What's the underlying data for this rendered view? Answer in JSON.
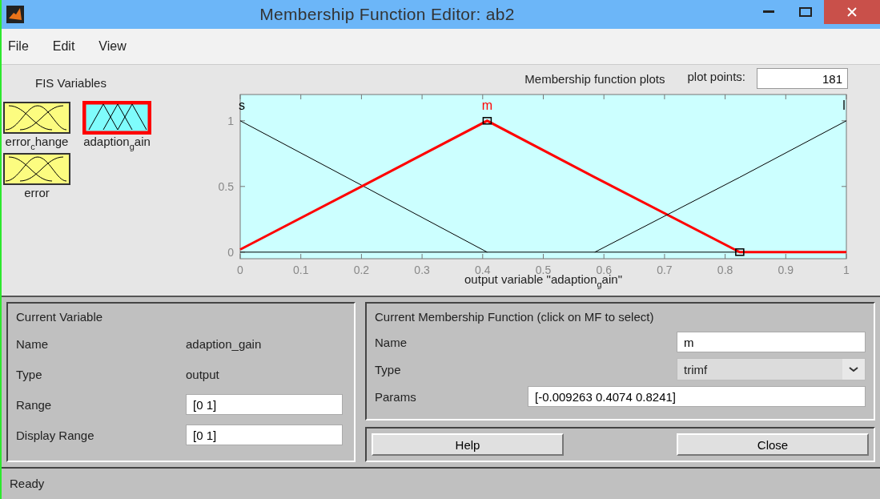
{
  "window": {
    "title": "Membership Function Editor: ab2"
  },
  "menu": [
    "File",
    "Edit",
    "View"
  ],
  "fis_variables": {
    "title": "FIS Variables",
    "items": [
      {
        "label": "error$_{c}$hange",
        "kind": "input",
        "selected": false
      },
      {
        "label": "adaption$_{g}$ain",
        "kind": "output",
        "selected": true
      },
      {
        "label": "error",
        "kind": "input",
        "selected": false
      }
    ]
  },
  "plot": {
    "title": "Membership function plots",
    "plot_points_label": "plot points:",
    "plot_points": "181",
    "chart_data": {
      "type": "line",
      "xlabel": "output variable \"adaption$_{g}$ain\"",
      "x": [
        0,
        0.2,
        0.4074,
        0.585,
        0.8241,
        1
      ],
      "series": [
        {
          "name": "s",
          "color": "#000000",
          "values": [
            1,
            0.51,
            0,
            null,
            null,
            null
          ]
        },
        {
          "name": "m",
          "color": "#ff0000",
          "values": [
            0.02,
            0.5,
            1,
            0.57,
            0,
            0
          ]
        },
        {
          "name": "l",
          "color": "#000000",
          "values": [
            null,
            null,
            null,
            0,
            0.57,
            1
          ]
        }
      ],
      "xlim": [
        0,
        1
      ],
      "ylim": [
        -0.05,
        1.2
      ],
      "xticks": [
        0,
        {
          "value": 0.1,
          "label": "0.1"
        },
        {
          "value": 0.2,
          "label": "0.2"
        },
        {
          "value": 0.3,
          "label": "0.3"
        },
        {
          "value": 0.4,
          "label": "0.4"
        },
        {
          "value": 0.5,
          "label": "0.5"
        },
        {
          "value": 0.6,
          "label": "0.6"
        },
        {
          "value": 0.7,
          "label": "0.7"
        },
        {
          "value": 0.8,
          "label": "0.8"
        },
        {
          "value": 0.9,
          "label": "0.9"
        },
        1
      ],
      "yticks": [
        0,
        0.5,
        1
      ]
    }
  },
  "current_variable": {
    "title": "Current Variable",
    "rows": [
      {
        "label": "Name",
        "kind": "text",
        "value": "adaption_gain"
      },
      {
        "label": "Type",
        "kind": "text",
        "value": "output"
      },
      {
        "label": "Range",
        "kind": "field",
        "value": "[0 1]"
      },
      {
        "label": "Display Range",
        "kind": "field",
        "value": "[0 1]"
      }
    ]
  },
  "current_mf": {
    "title": "Current Membership Function (click on MF to select)",
    "name_label": "Name",
    "name": "m",
    "type_label": "Type",
    "type": "trimf",
    "params_label": "Params",
    "params": "[-0.009263 0.4074 0.8241]"
  },
  "buttons": [
    "Help",
    "Close"
  ],
  "status_bar": "Ready"
}
